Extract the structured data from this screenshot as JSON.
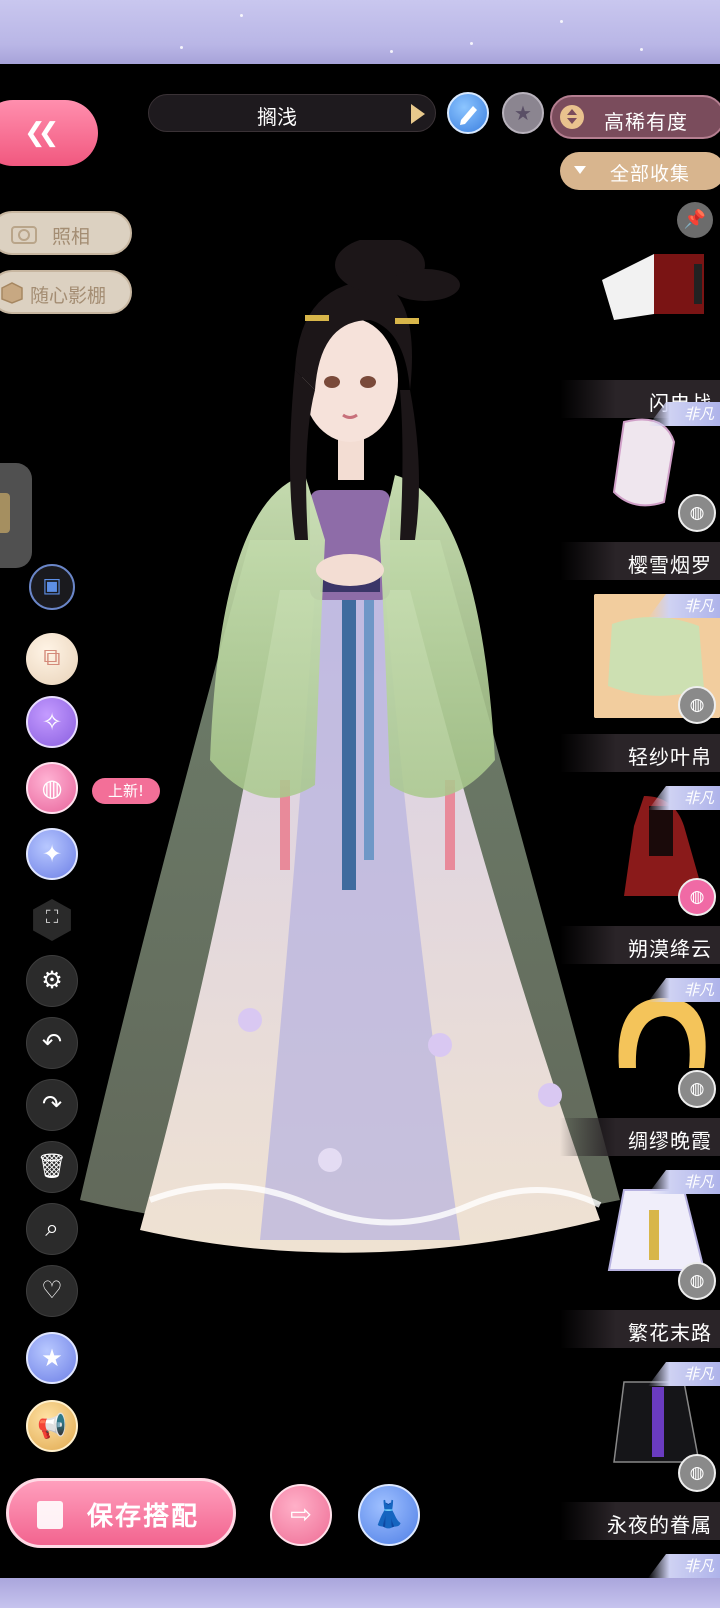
{
  "header": {
    "outfit_name": "搁浅",
    "sort_label": "高稀有度",
    "filter_label": "全部收集"
  },
  "left_panel": {
    "camera_label": "照相",
    "studio_label": "随心影棚",
    "new_badge": "上新!"
  },
  "icons": {
    "back": "double-chevron-left-icon",
    "edit": "pencil-icon",
    "favorite": "star-icon",
    "pin": "pin-icon",
    "dye": "paint-palette-icon"
  },
  "items": [
    {
      "name": "闪电战",
      "rarity": "",
      "selected": false
    },
    {
      "name": "樱雪烟罗",
      "rarity": "非凡",
      "selected": false
    },
    {
      "name": "轻纱叶帛",
      "rarity": "非凡",
      "selected": true
    },
    {
      "name": "朔漠绛云",
      "rarity": "非凡",
      "selected": false
    },
    {
      "name": "绸缪晚霞",
      "rarity": "非凡",
      "selected": false
    },
    {
      "name": "繁花末路",
      "rarity": "非凡",
      "selected": false
    },
    {
      "name": "永夜的眷属",
      "rarity": "非凡",
      "selected": false
    },
    {
      "name": "",
      "rarity": "非凡",
      "selected": false
    }
  ],
  "footer": {
    "save_label": "保存搭配"
  },
  "colors": {
    "accent_pink": "#f2648f",
    "accent_gold": "#d8b58e",
    "sort_bg": "#7a4c5c",
    "band_lavender": "#c9c7ef"
  }
}
